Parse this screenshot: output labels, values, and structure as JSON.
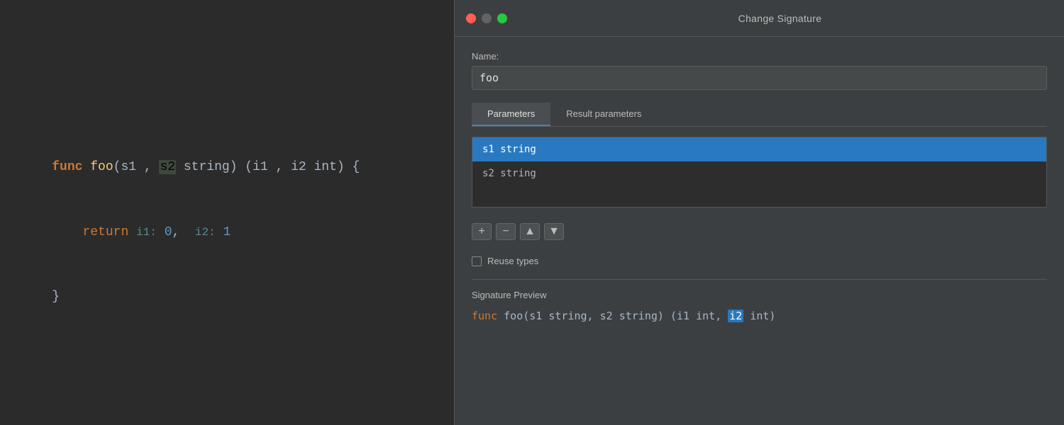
{
  "editor": {
    "lines": [
      {
        "type": "empty"
      },
      {
        "type": "empty"
      },
      {
        "type": "func_decl"
      },
      {
        "type": "return"
      },
      {
        "type": "close"
      }
    ],
    "func_keyword": "func",
    "func_name": "foo",
    "params": "s1 , s2 string",
    "result_params": "i1 , i2 int",
    "return_keyword": "return",
    "return_values": "i1: 0,  i2: 1"
  },
  "dialog": {
    "title": "Change Signature",
    "traffic_lights": [
      "red",
      "yellow",
      "green"
    ],
    "name_label": "Name:",
    "name_value": "foo",
    "tabs": [
      "Parameters",
      "Result parameters"
    ],
    "active_tab_index": 0,
    "parameters": [
      {
        "name": "s1 string",
        "selected": true
      },
      {
        "name": "s2 string",
        "selected": false
      }
    ],
    "toolbar_buttons": [
      "+",
      "−",
      "▲",
      "▼"
    ],
    "reuse_types_label": "Reuse types",
    "reuse_types_checked": false,
    "signature_preview_label": "Signature Preview",
    "signature_preview_func_kw": "func",
    "signature_preview_name": "foo",
    "signature_preview_params": "(s1 string, s2 string) (i1 int,",
    "signature_preview_highlighted": "i2",
    "signature_preview_end": "int)"
  }
}
